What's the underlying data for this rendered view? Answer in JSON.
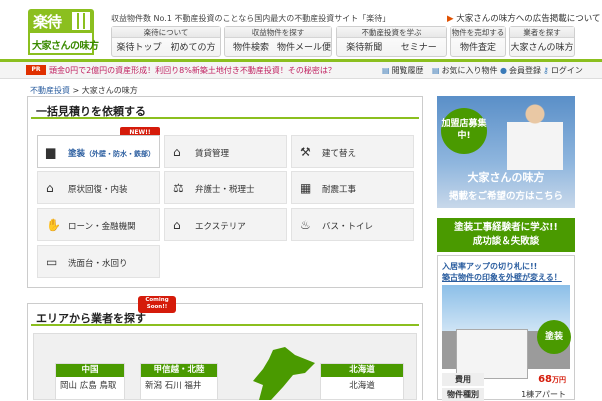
{
  "header": {
    "logo_top": "楽待",
    "logo_bottom": "大家さんの味方",
    "tagline": "収益物件数 No.1 不動産投資のことなら国内最大の不動産投資サイト「楽待」",
    "ad_link": "大家さんの味方への広告掲載について",
    "nav_groups": [
      {
        "caption": "楽待について",
        "items": [
          "楽待トップ",
          "初めての方"
        ]
      },
      {
        "caption": "収益物件を探す",
        "items": [
          "物件検索",
          "物件メール便"
        ]
      },
      {
        "caption": "不動産投資を学ぶ",
        "items": [
          "楽待新聞",
          "セミナー"
        ]
      },
      {
        "caption": "物件を売却する",
        "items": [
          "物件査定"
        ]
      },
      {
        "caption": "業者を探す",
        "items": [
          "大家さんの味方"
        ]
      }
    ]
  },
  "ticker": {
    "badge": "PR",
    "text": "頭金0円で2億円の資産形成！利回り8%新築土地付き不動産投資！その秘密は？",
    "utils": [
      "閲覧履歴",
      "お気に入り物件",
      "会員登録",
      "ログイン"
    ]
  },
  "breadcrumb": {
    "root": "不動産投資",
    "separator": ">",
    "current": "大家さんの味方"
  },
  "estimate": {
    "title": "一括見積りを依頼する",
    "new_badge": "NEW!!",
    "services": [
      {
        "label": "塗装",
        "note": "（外壁・防水・鉄部）",
        "icon": "paint-roller-icon"
      },
      {
        "label": "賃貸管理",
        "icon": "house-icon"
      },
      {
        "label": "建て替え",
        "icon": "demolition-icon"
      },
      {
        "label": "原状回復・内装",
        "icon": "house-icon"
      },
      {
        "label": "弁護士・税理士",
        "icon": "scales-icon"
      },
      {
        "label": "耐震工事",
        "icon": "brick-icon"
      },
      {
        "label": "ローン・金融機関",
        "icon": "handshake-icon"
      },
      {
        "label": "エクステリア",
        "icon": "house-icon"
      },
      {
        "label": "バス・トイレ",
        "icon": "bathtub-icon"
      },
      {
        "label": "洗面台・水回り",
        "icon": "sink-icon"
      }
    ]
  },
  "area": {
    "title": "エリアから業者を探す",
    "soon_badge": [
      "Coming",
      "Soon!!"
    ],
    "regions": [
      {
        "name": "中国",
        "prefs": "岡山 広島 鳥取"
      },
      {
        "name": "甲信越・北陸",
        "prefs": "新潟 石川 福井"
      },
      {
        "name": "北海道",
        "prefs": "北海道"
      }
    ]
  },
  "sidebar": {
    "banner1": {
      "circle": "加盟店募集中!",
      "line1": "大家さんの味方",
      "line2": "掲載をご希望の方はこちら"
    },
    "banner2": {
      "line1": "塗装工事経験者に学ぶ!!",
      "line2": "成功談＆失敗談"
    },
    "banner3": {
      "line1": "入居率アップの切り札に!!",
      "line2": "築古物件の印象を外壁が変える！",
      "paint_badge": "塗装",
      "rows": [
        {
          "key": "費用",
          "value": "68",
          "unit": "万円"
        },
        {
          "key": "物件種別",
          "value": "1棟アパート"
        }
      ]
    }
  }
}
